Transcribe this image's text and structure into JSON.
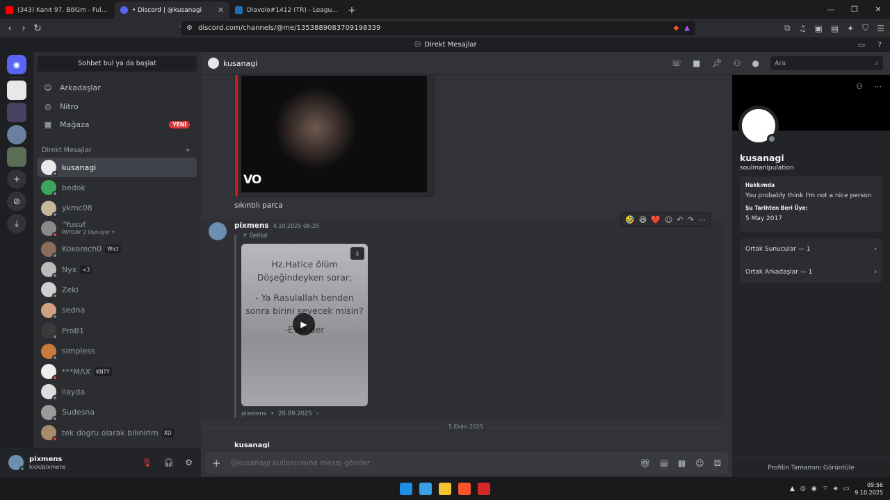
{
  "browser": {
    "tabs": [
      {
        "title": "(343) Kanıt 97. Bölüm - Full Bölüm - ",
        "color": "#ff0000"
      },
      {
        "title": "• Discord | @kusanagi",
        "color": "#5865f2"
      },
      {
        "title": "Diavolo#1412 (TR) - LeagueOfGraphs",
        "color": "#1f6fb2"
      }
    ],
    "url": "discord.com/channels/@me/1353889083709198339"
  },
  "window_title": "Direkt Mesajlar",
  "sidebar": {
    "find_button": "Sohbet bul ya da başlat",
    "nav": [
      {
        "label": "Arkadaşlar",
        "icon": "friends-icon"
      },
      {
        "label": "Nitro",
        "icon": "nitro-icon"
      },
      {
        "label": "Mağaza",
        "icon": "shop-icon",
        "badge": "YENİ"
      }
    ],
    "dm_header": "Direkt Mesajlar",
    "dm_add": "+",
    "dms": [
      {
        "name": "kusanagi",
        "color": "#e8e8e8",
        "sel": true
      },
      {
        "name": "bedok",
        "color": "#3ba55c"
      },
      {
        "name": "ykmc08",
        "color": "#c7b79a"
      },
      {
        "name": "\"Yusuf",
        "sub": "PAYDAY 2 Oynuyor •",
        "color": "#8a8a8a",
        "status": "#f23f43"
      },
      {
        "name": "Kokorech0",
        "tag": "Wict",
        "color": "#8b6d5c"
      },
      {
        "name": "Nyx",
        "tag": "<3",
        "color": "#bbbbbb"
      },
      {
        "name": "Zeki",
        "color": "#cfcfcf"
      },
      {
        "name": "sedna",
        "color": "#d0a080"
      },
      {
        "name": "ProB1",
        "color": "#3a3a3a"
      },
      {
        "name": "simpless",
        "color": "#c87b3a"
      },
      {
        "name": "***MΛX",
        "tag": "KNTY",
        "color": "#eeeeee",
        "status": "#f23f43"
      },
      {
        "name": "ilayda",
        "color": "#dddddd"
      },
      {
        "name": "Sudesna",
        "color": "#9a9a9a"
      },
      {
        "name": "tek dogru olarak bilinirim",
        "tag": "XD",
        "color": "#a88b6a",
        "status": "#f23f43"
      }
    ]
  },
  "user": {
    "name": "pixmens",
    "sub": "kick/pixmens"
  },
  "chat": {
    "title": "kusanagi",
    "search_placeholder": "Ara",
    "video1_logo": "VO",
    "msg1_text": "sıkıntılı parca",
    "msg2": {
      "author": "pixmens",
      "time": "4.10.2025 08:25",
      "forward_label": "İletildi",
      "video_lines": [
        "Hz.Hatice ölüm",
        "Döşeğindeyken sorar;",
        "",
        "- Ya Rasulallah benden",
        "sonra birini sevecek misin?",
        "-Evet der"
      ],
      "source": "pixmens",
      "source_date": "20.09.2025"
    },
    "date_divider": "5 Ekim 2025",
    "msg3_author": "kusanagi",
    "composer_placeholder": "@kusanagi kullanıcısına mesaj gönder",
    "reactions": [
      "🤣",
      "😆",
      "❤️"
    ]
  },
  "profile": {
    "name": "kusanagi",
    "username": "soulmanipulation",
    "about_header": "Hakkımda",
    "about": "You probably think I'm not a nice person",
    "since_header": "Şu Tarihten Beri Üye:",
    "since": "5 May 2017",
    "mutual_servers": "Ortak Sunucular — 1",
    "mutual_friends": "Ortak Arkadaşlar — 1",
    "full_profile": "Profilin Tamamını Görüntüle"
  },
  "clock": {
    "time": "09:56",
    "date": "9.10.2025"
  }
}
